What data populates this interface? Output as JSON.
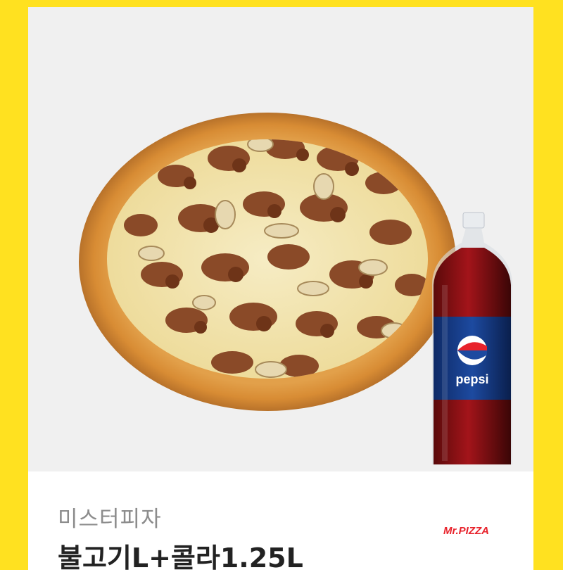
{
  "product": {
    "brand": "미스터피자",
    "title": "불고기L+콜라1.25L",
    "logo_text": "Mr.PIZZA",
    "bottle_label": "pepsi"
  },
  "colors": {
    "background": "#FFE120",
    "card": "#ffffff",
    "image_bg": "#f0f0f0",
    "logo": "#e8222b",
    "brand_text": "#8c8c8c",
    "title_text": "#222222"
  }
}
